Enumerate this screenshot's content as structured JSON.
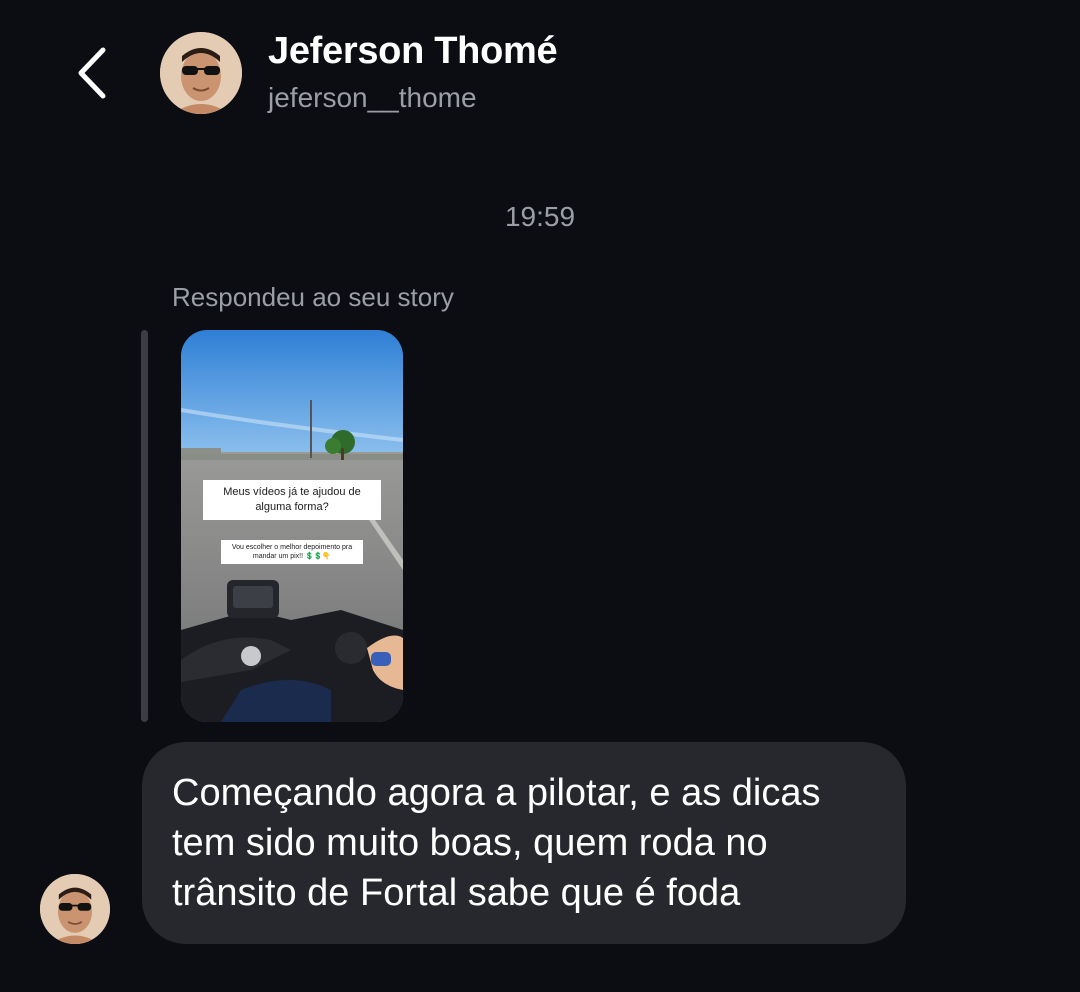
{
  "header": {
    "back_icon": "chevron-left-icon",
    "name": "Jeferson Thomé",
    "username": "jeferson__thome"
  },
  "conversation": {
    "timestamp": "19:59",
    "story_reply": {
      "caption": "Respondeu ao seu story",
      "story_question": "Meus vídeos já te ajudou de alguma forma?",
      "story_subtext": "Vou escolher o melhor depoimento pra mandar um pix!! 💲💲👇"
    },
    "message": {
      "text": "Começando agora a pilotar, e as dicas tem sido muito boas, quem roda no trânsito de Fortal sabe que é foda"
    }
  },
  "colors": {
    "background": "#0b0d12",
    "bubble": "#26282d",
    "secondary_text": "#9b9ea6",
    "primary_text": "#ffffff"
  }
}
